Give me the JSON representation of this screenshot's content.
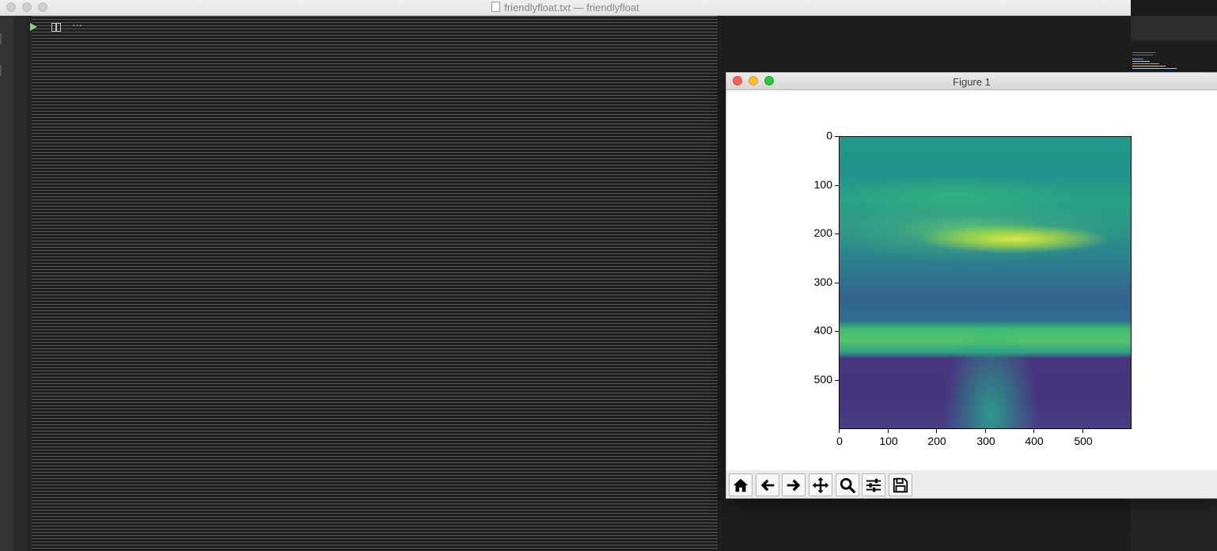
{
  "editor": {
    "title": "friendlyfloat.txt — friendlyfloat"
  },
  "right_panel": {
    "toolbar_icons": [
      "run-icon",
      "split-editor-icon",
      "more-actions-icon"
    ],
    "more_label": "···"
  },
  "figure": {
    "window_title": "Figure 1",
    "colormap": "viridis",
    "image_description_colors": {
      "sky": "#21918c",
      "clouds_highlight": "#dfe64a",
      "grass": "#3fbc73",
      "field_dark": "#46337e"
    },
    "y_ticks": [
      "0",
      "100",
      "200",
      "300",
      "400",
      "500"
    ],
    "x_ticks": [
      "0",
      "100",
      "200",
      "300",
      "400",
      "500"
    ],
    "axis_range": {
      "x": [
        0,
        600
      ],
      "y": [
        600,
        0
      ]
    },
    "toolbar": [
      {
        "name": "home-icon",
        "action": "Home"
      },
      {
        "name": "back-icon",
        "action": "Back"
      },
      {
        "name": "forward-icon",
        "action": "Forward"
      },
      {
        "name": "pan-icon",
        "action": "Pan"
      },
      {
        "name": "zoom-icon",
        "action": "Zoom"
      },
      {
        "name": "configure-subplots-icon",
        "action": "Subplots"
      },
      {
        "name": "save-icon",
        "action": "Save"
      }
    ]
  }
}
